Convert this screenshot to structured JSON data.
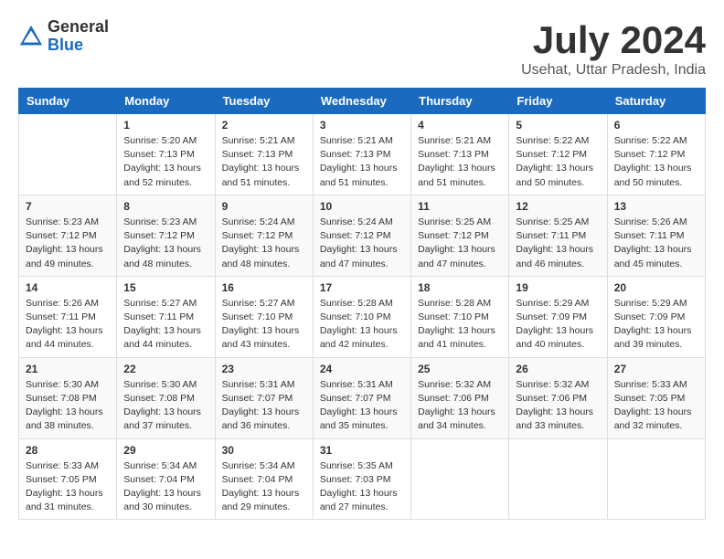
{
  "logo": {
    "general": "General",
    "blue": "Blue"
  },
  "header": {
    "month": "July 2024",
    "location": "Usehat, Uttar Pradesh, India"
  },
  "days_of_week": [
    "Sunday",
    "Monday",
    "Tuesday",
    "Wednesday",
    "Thursday",
    "Friday",
    "Saturday"
  ],
  "weeks": [
    [
      {
        "day": "",
        "info": ""
      },
      {
        "day": "1",
        "info": "Sunrise: 5:20 AM\nSunset: 7:13 PM\nDaylight: 13 hours\nand 52 minutes."
      },
      {
        "day": "2",
        "info": "Sunrise: 5:21 AM\nSunset: 7:13 PM\nDaylight: 13 hours\nand 51 minutes."
      },
      {
        "day": "3",
        "info": "Sunrise: 5:21 AM\nSunset: 7:13 PM\nDaylight: 13 hours\nand 51 minutes."
      },
      {
        "day": "4",
        "info": "Sunrise: 5:21 AM\nSunset: 7:13 PM\nDaylight: 13 hours\nand 51 minutes."
      },
      {
        "day": "5",
        "info": "Sunrise: 5:22 AM\nSunset: 7:12 PM\nDaylight: 13 hours\nand 50 minutes."
      },
      {
        "day": "6",
        "info": "Sunrise: 5:22 AM\nSunset: 7:12 PM\nDaylight: 13 hours\nand 50 minutes."
      }
    ],
    [
      {
        "day": "7",
        "info": "Sunrise: 5:23 AM\nSunset: 7:12 PM\nDaylight: 13 hours\nand 49 minutes."
      },
      {
        "day": "8",
        "info": "Sunrise: 5:23 AM\nSunset: 7:12 PM\nDaylight: 13 hours\nand 48 minutes."
      },
      {
        "day": "9",
        "info": "Sunrise: 5:24 AM\nSunset: 7:12 PM\nDaylight: 13 hours\nand 48 minutes."
      },
      {
        "day": "10",
        "info": "Sunrise: 5:24 AM\nSunset: 7:12 PM\nDaylight: 13 hours\nand 47 minutes."
      },
      {
        "day": "11",
        "info": "Sunrise: 5:25 AM\nSunset: 7:12 PM\nDaylight: 13 hours\nand 47 minutes."
      },
      {
        "day": "12",
        "info": "Sunrise: 5:25 AM\nSunset: 7:11 PM\nDaylight: 13 hours\nand 46 minutes."
      },
      {
        "day": "13",
        "info": "Sunrise: 5:26 AM\nSunset: 7:11 PM\nDaylight: 13 hours\nand 45 minutes."
      }
    ],
    [
      {
        "day": "14",
        "info": "Sunrise: 5:26 AM\nSunset: 7:11 PM\nDaylight: 13 hours\nand 44 minutes."
      },
      {
        "day": "15",
        "info": "Sunrise: 5:27 AM\nSunset: 7:11 PM\nDaylight: 13 hours\nand 44 minutes."
      },
      {
        "day": "16",
        "info": "Sunrise: 5:27 AM\nSunset: 7:10 PM\nDaylight: 13 hours\nand 43 minutes."
      },
      {
        "day": "17",
        "info": "Sunrise: 5:28 AM\nSunset: 7:10 PM\nDaylight: 13 hours\nand 42 minutes."
      },
      {
        "day": "18",
        "info": "Sunrise: 5:28 AM\nSunset: 7:10 PM\nDaylight: 13 hours\nand 41 minutes."
      },
      {
        "day": "19",
        "info": "Sunrise: 5:29 AM\nSunset: 7:09 PM\nDaylight: 13 hours\nand 40 minutes."
      },
      {
        "day": "20",
        "info": "Sunrise: 5:29 AM\nSunset: 7:09 PM\nDaylight: 13 hours\nand 39 minutes."
      }
    ],
    [
      {
        "day": "21",
        "info": "Sunrise: 5:30 AM\nSunset: 7:08 PM\nDaylight: 13 hours\nand 38 minutes."
      },
      {
        "day": "22",
        "info": "Sunrise: 5:30 AM\nSunset: 7:08 PM\nDaylight: 13 hours\nand 37 minutes."
      },
      {
        "day": "23",
        "info": "Sunrise: 5:31 AM\nSunset: 7:07 PM\nDaylight: 13 hours\nand 36 minutes."
      },
      {
        "day": "24",
        "info": "Sunrise: 5:31 AM\nSunset: 7:07 PM\nDaylight: 13 hours\nand 35 minutes."
      },
      {
        "day": "25",
        "info": "Sunrise: 5:32 AM\nSunset: 7:06 PM\nDaylight: 13 hours\nand 34 minutes."
      },
      {
        "day": "26",
        "info": "Sunrise: 5:32 AM\nSunset: 7:06 PM\nDaylight: 13 hours\nand 33 minutes."
      },
      {
        "day": "27",
        "info": "Sunrise: 5:33 AM\nSunset: 7:05 PM\nDaylight: 13 hours\nand 32 minutes."
      }
    ],
    [
      {
        "day": "28",
        "info": "Sunrise: 5:33 AM\nSunset: 7:05 PM\nDaylight: 13 hours\nand 31 minutes."
      },
      {
        "day": "29",
        "info": "Sunrise: 5:34 AM\nSunset: 7:04 PM\nDaylight: 13 hours\nand 30 minutes."
      },
      {
        "day": "30",
        "info": "Sunrise: 5:34 AM\nSunset: 7:04 PM\nDaylight: 13 hours\nand 29 minutes."
      },
      {
        "day": "31",
        "info": "Sunrise: 5:35 AM\nSunset: 7:03 PM\nDaylight: 13 hours\nand 27 minutes."
      },
      {
        "day": "",
        "info": ""
      },
      {
        "day": "",
        "info": ""
      },
      {
        "day": "",
        "info": ""
      }
    ]
  ]
}
